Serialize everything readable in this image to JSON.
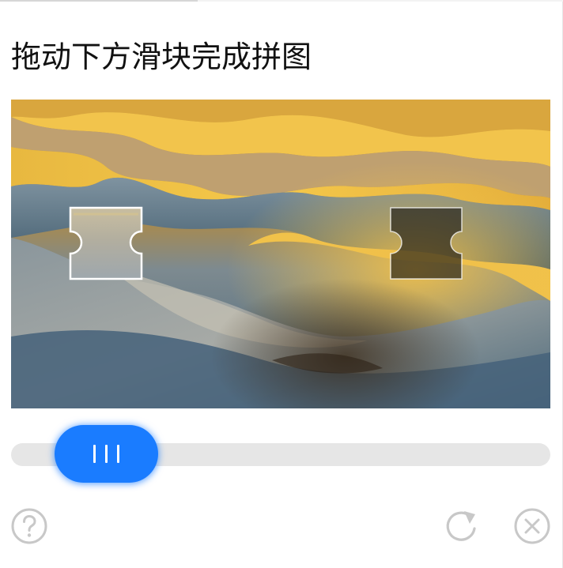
{
  "captcha": {
    "title": "拖动下方滑块完成拼图",
    "slider": {
      "position_fraction": 0.08
    },
    "icons": {
      "help": "help-circle-icon",
      "refresh": "refresh-icon",
      "close": "close-circle-icon",
      "grip": "grip-lines-icon"
    },
    "colors": {
      "accent": "#1a7cff",
      "track": "#e6e6e6",
      "icon_gray": "#c8c8c8",
      "title_text": "#111111"
    }
  }
}
